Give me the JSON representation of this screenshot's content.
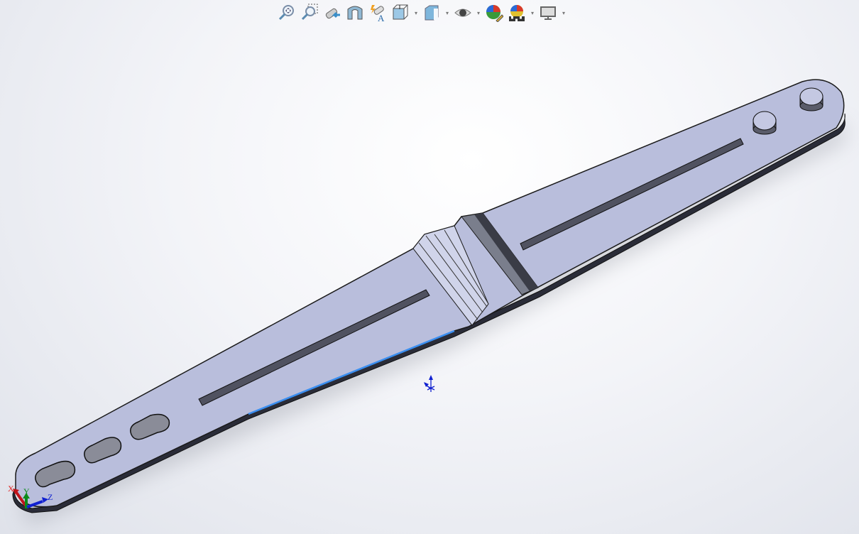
{
  "toolbar": {
    "items": [
      {
        "icon": "zoom-to-fit-icon",
        "dropdown": false
      },
      {
        "icon": "zoom-to-area-icon",
        "dropdown": false
      },
      {
        "icon": "previous-view-icon",
        "dropdown": false
      },
      {
        "icon": "section-view-icon",
        "dropdown": false
      },
      {
        "icon": "dynamic-annotation-views-icon",
        "dropdown": false
      },
      {
        "icon": "view-orientation-icon",
        "dropdown": true
      },
      {
        "icon": "display-style-icon",
        "dropdown": true
      },
      {
        "icon": "hide-show-items-icon",
        "dropdown": true
      },
      {
        "icon": "edit-appearance-icon",
        "dropdown": false
      },
      {
        "icon": "apply-scene-icon",
        "dropdown": true
      },
      {
        "icon": "view-settings-icon",
        "dropdown": true
      }
    ]
  },
  "triad": {
    "x_label": "X",
    "y_label": "Y",
    "z_label": "Z",
    "x_color": "#c0141a",
    "y_color": "#0a8a1a",
    "z_color": "#1020d0"
  },
  "model": {
    "face_color": "#b9bedc",
    "edge_color": "#1a1a1a",
    "selected_edge_color": "#3a8ef0"
  }
}
